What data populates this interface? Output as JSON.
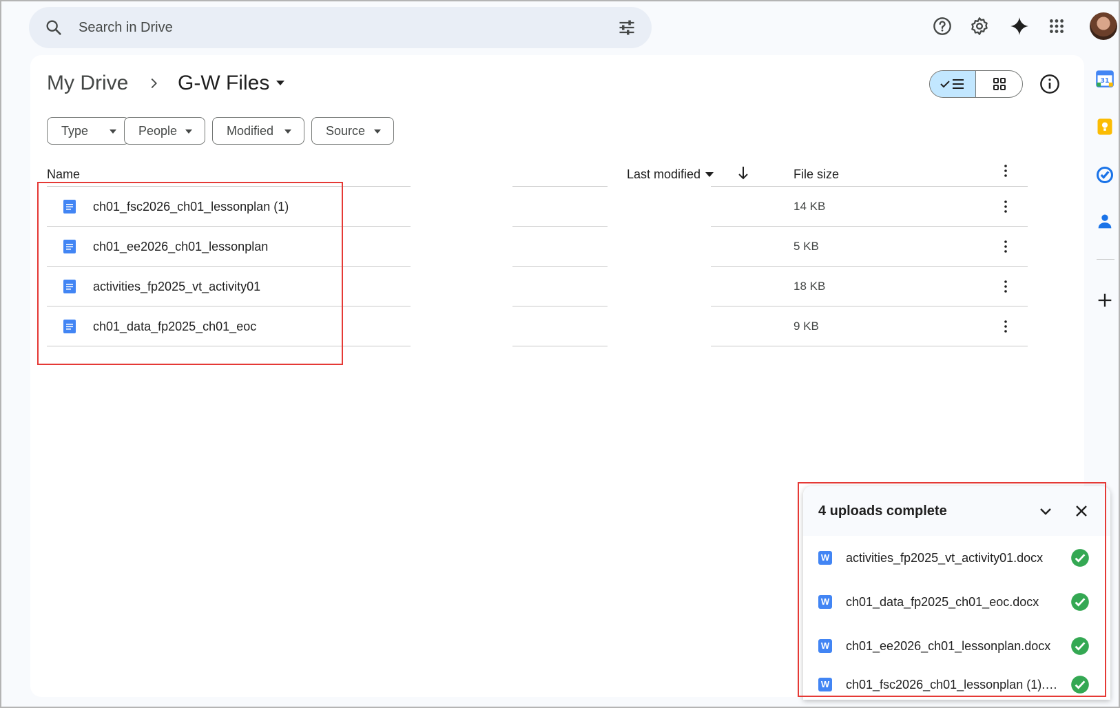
{
  "search": {
    "placeholder": "Search in Drive"
  },
  "top_icons": [
    "help-icon",
    "settings-icon",
    "gemini-icon",
    "apps-grid-icon"
  ],
  "breadcrumb": {
    "root": "My Drive",
    "folder": "G-W Files"
  },
  "filters": [
    "Type",
    "People",
    "Modified",
    "Source"
  ],
  "columns": {
    "name": "Name",
    "last_modified": "Last modified",
    "file_size": "File size"
  },
  "files": [
    {
      "name": "ch01_fsc2026_ch01_lessonplan (1)",
      "size": "14 KB"
    },
    {
      "name": "ch01_ee2026_ch01_lessonplan",
      "size": "5 KB"
    },
    {
      "name": "activities_fp2025_vt_activity01",
      "size": "18 KB"
    },
    {
      "name": "ch01_data_fp2025_ch01_eoc",
      "size": "9 KB"
    }
  ],
  "uploads": {
    "title": "4 uploads complete",
    "items": [
      "activities_fp2025_vt_activity01.docx",
      "ch01_data_fp2025_ch01_eoc.docx",
      "ch01_ee2026_ch01_lessonplan.docx",
      "ch01_fsc2026_ch01_lessonplan (1).do..."
    ]
  },
  "side_panel": [
    "calendar-icon",
    "keep-icon",
    "tasks-icon",
    "contacts-icon",
    "add-icon"
  ],
  "colors": {
    "accent": "#c2e7ff",
    "doc_blue": "#4285f4",
    "check_green": "#34a853",
    "highlight": "#e53935"
  }
}
